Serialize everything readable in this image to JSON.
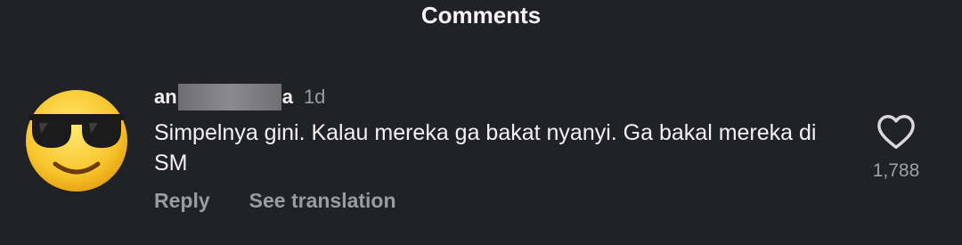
{
  "header": {
    "title": "Comments"
  },
  "comment": {
    "username_start": "an",
    "username_end": "a",
    "time": "1d",
    "text": "Simpelnya gini. Kalau mereka ga bakat nyanyi. Ga bakal mereka di SM",
    "like_count": "1,788",
    "reply_label": "Reply",
    "translate_label": "See translation",
    "avatar_icon": "smiling-face-with-sunglasses-icon",
    "like_icon": "heart-outline-icon"
  }
}
